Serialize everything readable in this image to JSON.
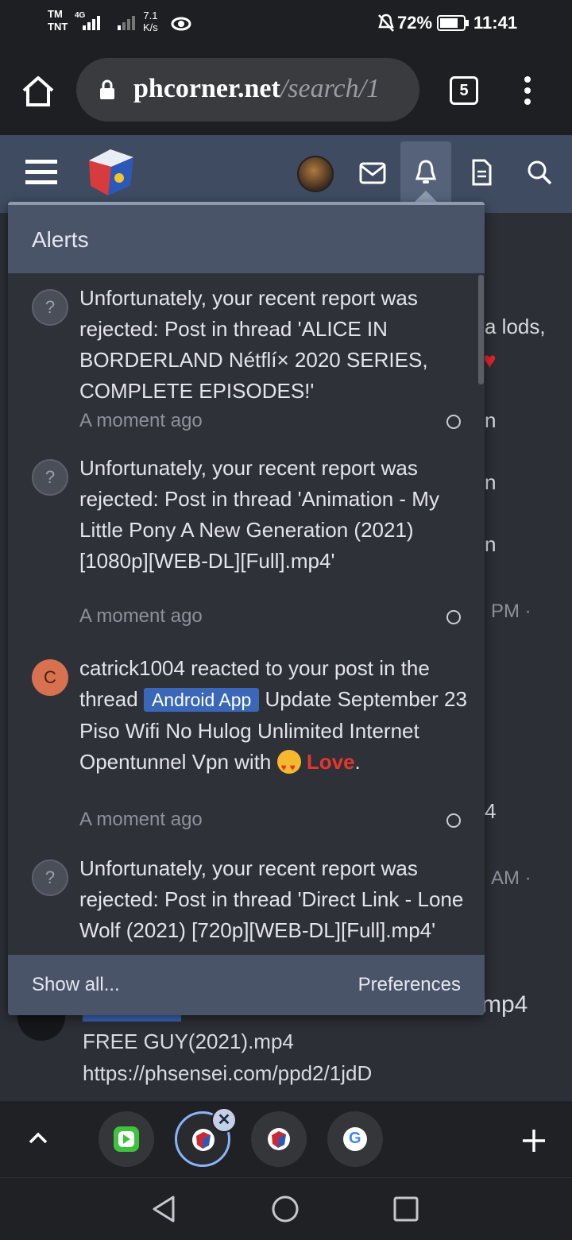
{
  "status": {
    "carrier_top": "TM",
    "carrier_bottom": "TNT",
    "network": "4G",
    "speed_value": "7.1",
    "speed_unit": "K/s",
    "battery": "72%",
    "time": "11:41"
  },
  "browser": {
    "url_host": "phcorner.net",
    "url_path": "/search/1",
    "tab_count": "5"
  },
  "background_page": {
    "lines": [
      {
        "text": "a lods,"
      },
      {
        "text": "n"
      },
      {
        "text": "n"
      },
      {
        "text": "n"
      },
      {
        "text": "PM ·"
      },
      {
        "text": "4"
      },
      {
        "text": "AM ·"
      },
      {
        "text": "mp4"
      },
      {
        "text": "FREE GUY(2021).mp4"
      },
      {
        "text": "https://phsensei.com/ppd2/1jdD"
      }
    ]
  },
  "alerts": {
    "title": "Alerts",
    "items": [
      {
        "avatar": "?",
        "text": "Unfortunately, your recent report was rejected: Post in thread 'ALICE IN BORDERLAND Nétflí× 2020 SERIES, COMPLETE EPISODES!'",
        "time": "A moment ago"
      },
      {
        "avatar": "?",
        "text": "Unfortunately, your recent report was rejected: Post in thread 'Animation - My Little Pony A New Generation (2021) [1080p][WEB-DL][Full].mp4'",
        "time": "A moment ago"
      },
      {
        "avatar": "C",
        "text_before": "catrick1004 reacted to your post in the thread",
        "label": "Android App",
        "text_after": "Update September 23 Piso Wifi No Hulog Unlimited Internet Opentunnel Vpn with",
        "reaction": "Love",
        "period": ".",
        "time": "A moment ago"
      },
      {
        "avatar": "?",
        "text": "Unfortunately, your recent report was rejected: Post in thread 'Direct Link - Lone Wolf (2021) [720p][WEB-DL][Full].mp4'",
        "time": ""
      }
    ],
    "show_all": "Show all...",
    "preferences": "Preferences"
  },
  "colors": {
    "header": "#3e4b61",
    "panel": "#2f3139",
    "accent_label": "#3a67b8",
    "love": "#e5362c",
    "avatar_c": "#d7714f"
  }
}
